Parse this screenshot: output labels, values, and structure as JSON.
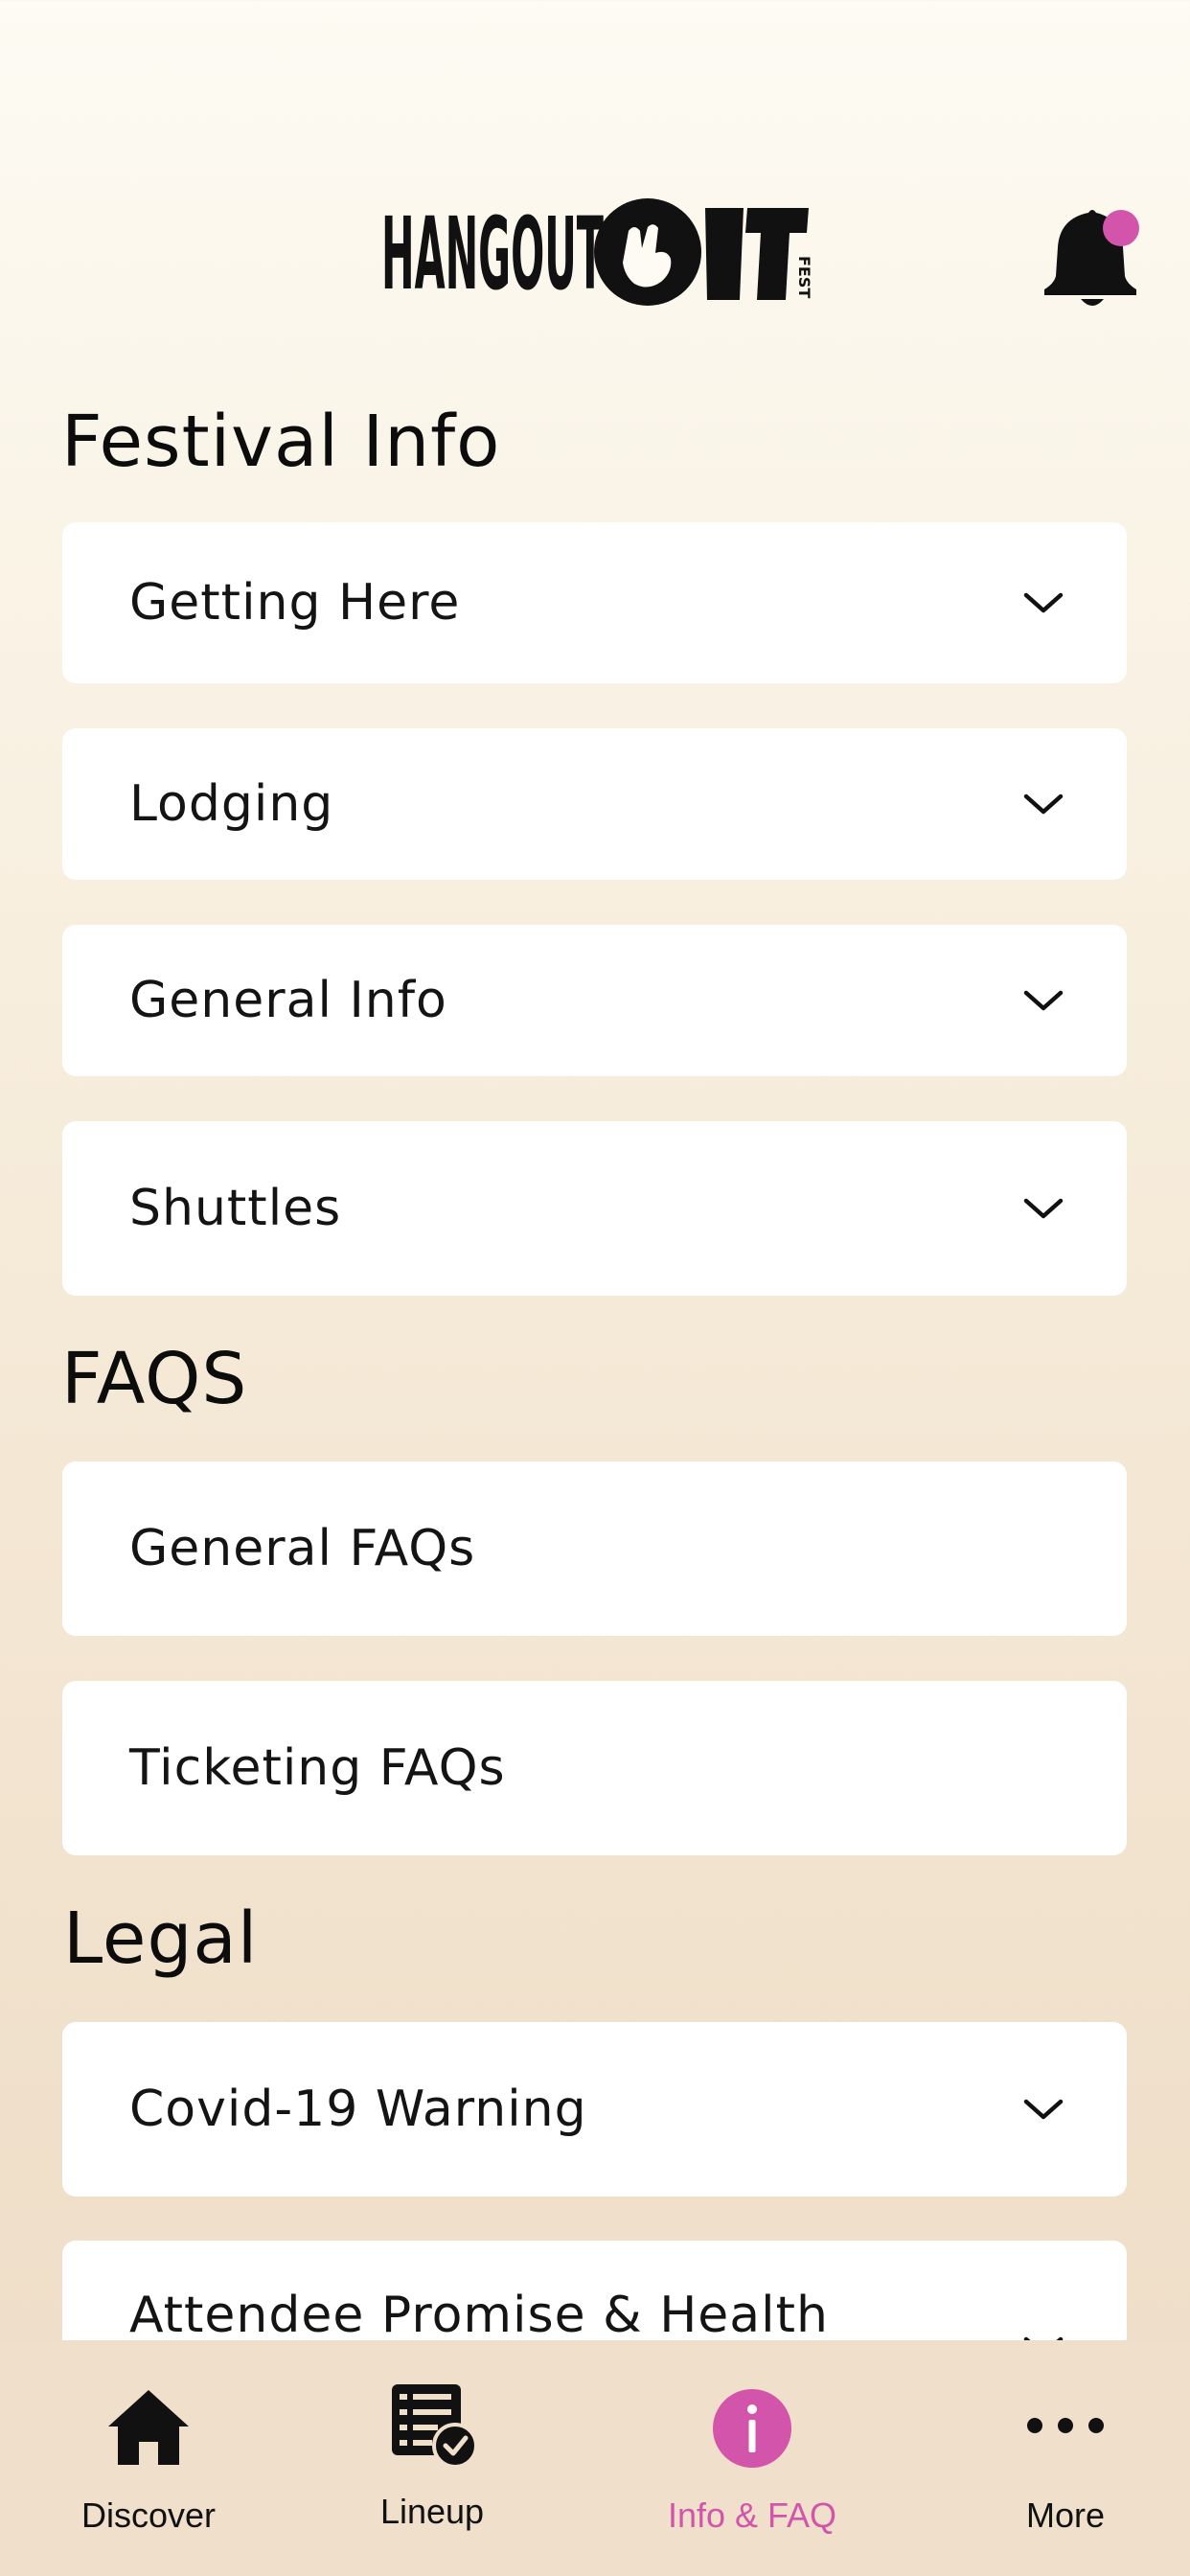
{
  "header": {
    "logo_text": "HANGOUT",
    "logo_sub": "FEST",
    "notification_dot_color": "#d255ab"
  },
  "sections": {
    "festival_info": {
      "title": "Festival Info",
      "items": [
        {
          "label": "Getting Here",
          "icon": "chevron-down-icon"
        },
        {
          "label": "Lodging",
          "icon": "chevron-down-icon"
        },
        {
          "label": "General Info",
          "icon": "chevron-down-icon"
        },
        {
          "label": "Shuttles",
          "icon": "chevron-down-icon"
        }
      ]
    },
    "faqs": {
      "title": "FAQS",
      "items": [
        {
          "label": "General FAQs"
        },
        {
          "label": "Ticketing FAQs"
        }
      ]
    },
    "legal": {
      "title": "Legal",
      "items": [
        {
          "label": "Covid-19 Warning",
          "icon": "chevron-down-icon"
        },
        {
          "label": "Attendee Promise & Health",
          "icon": "chevron-down-icon"
        }
      ]
    }
  },
  "tabbar": {
    "accent_color": "#d255ab",
    "tabs": [
      {
        "label": "Discover",
        "icon": "home-icon",
        "active": false
      },
      {
        "label": "Lineup",
        "icon": "lineup-checklist-icon",
        "active": false
      },
      {
        "label": "Info & FAQ",
        "icon": "info-icon",
        "active": true
      },
      {
        "label": "More",
        "icon": "more-dots-icon",
        "active": false
      }
    ]
  }
}
